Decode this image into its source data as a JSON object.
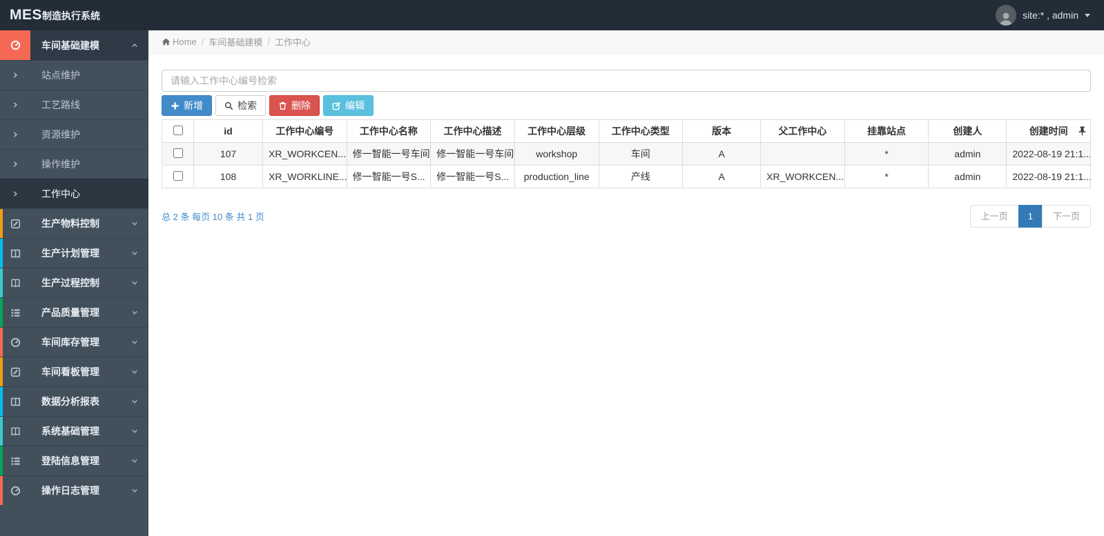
{
  "navbar": {
    "logo_bold": "MES",
    "logo_text": "制造执行系统",
    "user_name": "site:* , admin"
  },
  "breadcrumb": {
    "home_label": "Home",
    "separator": "/",
    "items": [
      "车间基础建模",
      "工作中心"
    ]
  },
  "sidebar": {
    "items": [
      {
        "label": "车间基础建模",
        "icon": "gauge-icon",
        "state": "active-parent",
        "stripe": null
      },
      {
        "label": "站点维护",
        "icon": "chevron-right-icon",
        "state": "sub"
      },
      {
        "label": "工艺路线",
        "icon": "chevron-right-icon",
        "state": "sub"
      },
      {
        "label": "资源维护",
        "icon": "chevron-right-icon",
        "state": "sub"
      },
      {
        "label": "操作维护",
        "icon": "chevron-right-icon",
        "state": "sub"
      },
      {
        "label": "工作中心",
        "icon": "chevron-right-icon",
        "state": "sub-selected"
      },
      {
        "label": "生产物料控制",
        "icon": "pencil-square-icon",
        "stripe": "#f39c12"
      },
      {
        "label": "生产计划管理",
        "icon": "columns-icon",
        "stripe": "#00c0ef"
      },
      {
        "label": "生产过程控制",
        "icon": "book-icon",
        "stripe": "#39cccc"
      },
      {
        "label": "产品质量管理",
        "icon": "list-icon",
        "stripe": "#00a65a"
      },
      {
        "label": "车间库存管理",
        "icon": "gauge-icon",
        "stripe": "#f56954"
      },
      {
        "label": "车间看板管理",
        "icon": "pencil-square-icon",
        "stripe": "#f39c12"
      },
      {
        "label": "数据分析报表",
        "icon": "columns-icon",
        "stripe": "#00c0ef"
      },
      {
        "label": "系统基础管理",
        "icon": "book-icon",
        "stripe": "#39cccc"
      },
      {
        "label": "登陆信息管理",
        "icon": "list-icon",
        "stripe": "#00a65a"
      },
      {
        "label": "操作日志管理",
        "icon": "gauge-icon",
        "stripe": "#f56954"
      }
    ]
  },
  "search": {
    "placeholder": "请输入工作中心编号检索",
    "value": ""
  },
  "toolbar": {
    "add_label": "新增",
    "search_label": "检索",
    "delete_label": "删除",
    "edit_label": "编辑"
  },
  "table": {
    "headers": [
      "id",
      "工作中心编号",
      "工作中心名称",
      "工作中心描述",
      "工作中心层级",
      "工作中心类型",
      "版本",
      "父工作中心",
      "挂靠站点",
      "创建人",
      "创建时间"
    ],
    "rows": [
      {
        "cells": [
          "107",
          "XR_WORKCEN...",
          "修一智能一号车间",
          "修一智能一号车间",
          "workshop",
          "车间",
          "A",
          "",
          "*",
          "admin",
          "2022-08-19 21:1..."
        ]
      },
      {
        "cells": [
          "108",
          "XR_WORKLINE...",
          "修一智能一号S...",
          "修一智能一号S...",
          "production_line",
          "产线",
          "A",
          "XR_WORKCEN...",
          "*",
          "admin",
          "2022-08-19 21:1..."
        ]
      }
    ]
  },
  "pagination": {
    "summary": "总 2 条 每页 10 条 共 1 页",
    "prev_label": "上一页",
    "current_page": "1",
    "next_label": "下一页"
  },
  "colors": {
    "navbar_bg": "#222d38",
    "sidebar_bg": "#42505c",
    "active_icon_red": "#f56954",
    "primary_blue": "#428bca",
    "active_page_blue": "#337ab7",
    "danger_red": "#d9534f",
    "info_cyan": "#5bc0de",
    "stripe_yellow": "#f39c12",
    "stripe_aqua": "#00c0ef",
    "stripe_teal": "#39cccc",
    "stripe_green": "#00a65a",
    "stripe_red": "#f56954"
  }
}
